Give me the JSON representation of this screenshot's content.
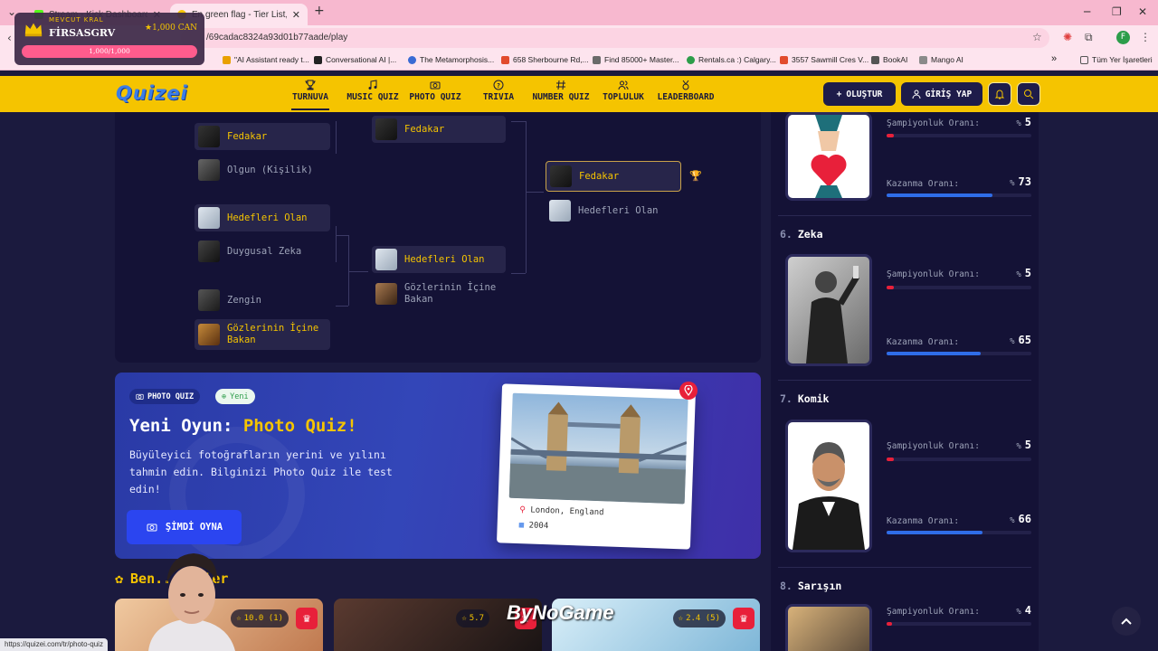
{
  "browser": {
    "tabs": [
      {
        "label": "Stream - Kick Dashboard"
      },
      {
        "label": "En green flag - Tier List, Kör Sır..."
      }
    ],
    "url": "/69cadac8324a93d01b77aade/play",
    "bookmarks": [
      {
        "label": "\"AI Assistant ready t...",
        "color": "#e9a000"
      },
      {
        "label": "Conversational AI |...",
        "color": "#222222"
      },
      {
        "label": "The Metamorphosis...",
        "color": "#3a6bd4"
      },
      {
        "label": "658 Sherbourne Rd,...",
        "color": "#e24b2d"
      },
      {
        "label": "Find 85000+ Master...",
        "color": "#6a6a6a"
      },
      {
        "label": "Rentals.ca :) Calgary...",
        "color": "#2d9d4a"
      },
      {
        "label": "3557 Sawmill Cres V...",
        "color": "#e24b2d"
      },
      {
        "label": "BookAI",
        "color": "#555555"
      },
      {
        "label": "Mango AI",
        "color": "#8a8a8a"
      }
    ],
    "all_bookmarks": "Tüm Yer İşaretleri",
    "status_url": "https://quizei.com/tr/photo-quiz",
    "profile_initial": "F"
  },
  "king": {
    "caption": "MEVCUT KRAL",
    "name": "FİRSASGRV",
    "coins": "1,000 CAN",
    "progress_text": "1,000/1,000",
    "progress": 1.0
  },
  "header": {
    "logo": "Quizei",
    "nav": [
      {
        "label": "TURNUVA",
        "icon": "trophy-icon",
        "active": true
      },
      {
        "label": "MUSIC QUIZ",
        "icon": "music-icon"
      },
      {
        "label": "PHOTO QUIZ",
        "icon": "camera-icon"
      },
      {
        "label": "TRIVIA",
        "icon": "question-icon"
      },
      {
        "label": "NUMBER QUIZ",
        "icon": "hash-icon"
      },
      {
        "label": "TOPLULUK",
        "icon": "users-icon"
      },
      {
        "label": "LEADERBOARD",
        "icon": "medal-icon"
      }
    ],
    "create_label": "OLUŞTUR",
    "login_label": "GİRİŞ YAP"
  },
  "bracket": {
    "round1": [
      {
        "label": "Fedakar",
        "winner": true
      },
      {
        "label": "Olgun (Kişilik)",
        "winner": false
      },
      {
        "label": "Hedefleri Olan",
        "winner": true
      },
      {
        "label": "Duygusal Zeka",
        "winner": false
      },
      {
        "label": "Zengin",
        "winner": false
      },
      {
        "label": "Gözlerinin İçine Bakan",
        "winner": true
      }
    ],
    "round2": [
      {
        "label": "Fedakar",
        "winner": true
      },
      {
        "label": "Hedefleri Olan",
        "winner": true
      },
      {
        "label": "Gözlerinin İçine Bakan",
        "winner": false
      }
    ],
    "final": [
      {
        "label": "Fedakar",
        "winner": true
      },
      {
        "label": "Hedefleri Olan",
        "winner": false
      }
    ]
  },
  "promo": {
    "chip_label": "PHOTO QUIZ",
    "new_label": "Yeni",
    "title_prefix": "Yeni Oyun: ",
    "title_highlight": "Photo Quiz!",
    "description": "Büyüleyici fotoğrafların yerini ve yılını tahmin edin. Bilginizi Photo Quiz ile test edin!",
    "button_label": "ŞİMDİ OYNA",
    "photo_location": "London, England",
    "photo_year": "2004"
  },
  "favorites": {
    "title": "Ben... izler",
    "cards": [
      {
        "rating": "10.0 (1)"
      },
      {
        "rating": "5.7"
      },
      {
        "rating": "2.4 (5)"
      }
    ],
    "watermark": "ByNoGame"
  },
  "ranking": {
    "champ_label": "Şampiyonluk Oranı:",
    "win_label": "Kazanma Oranı:",
    "pct_sign": "%",
    "items": [
      {
        "rank": "",
        "name": "",
        "champ": "5",
        "win": "73",
        "champ_frac": 0.05,
        "win_frac": 0.73
      },
      {
        "rank": "6.",
        "name": "Zeka",
        "champ": "5",
        "win": "65",
        "champ_frac": 0.05,
        "win_frac": 0.65
      },
      {
        "rank": "7.",
        "name": "Komik",
        "champ": "5",
        "win": "66",
        "champ_frac": 0.05,
        "win_frac": 0.66
      },
      {
        "rank": "8.",
        "name": "Sarışın",
        "champ": "4",
        "win": "",
        "champ_frac": 0.04,
        "win_frac": 0
      }
    ]
  },
  "colors": {
    "accent_yellow": "#f5c400",
    "navy": "#141236",
    "blue_bar": "#2f6de8",
    "red_bar": "#e8203a"
  }
}
